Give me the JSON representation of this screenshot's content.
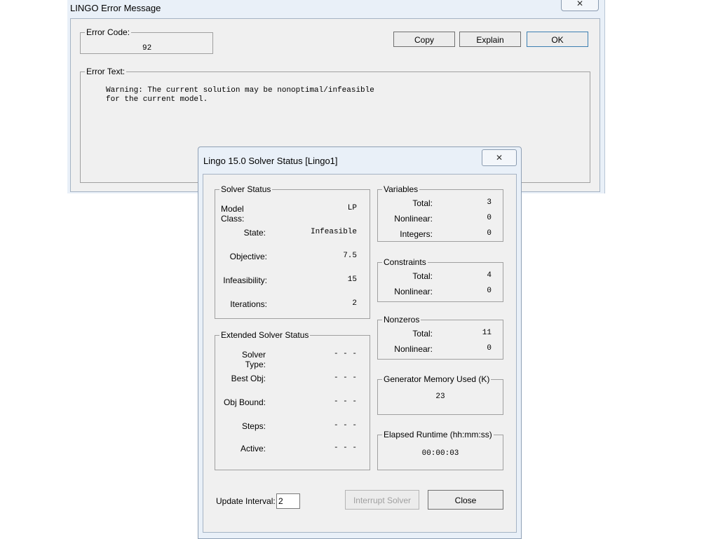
{
  "error_window": {
    "title": "LINGO Error Message",
    "close_glyph": "✕",
    "error_code": {
      "label": "Error Code:",
      "value": "92"
    },
    "buttons": {
      "copy": "Copy",
      "explain": "Explain",
      "ok": "OK"
    },
    "error_text": {
      "label": "Error Text:",
      "line1": "Warning: The current solution may be nonoptimal/infeasible",
      "line2": "for the current model."
    }
  },
  "solver_window": {
    "title": "Lingo 15.0 Solver Status [Lingo1]",
    "close_glyph": "✕",
    "solver_status": {
      "legend": "Solver Status",
      "model_class": {
        "label": "Model Class:",
        "value": "LP"
      },
      "state": {
        "label": "State:",
        "value": "Infeasible"
      },
      "objective": {
        "label": "Objective:",
        "value": "7.5"
      },
      "infeasibility": {
        "label": "Infeasibility:",
        "value": "15"
      },
      "iterations": {
        "label": "Iterations:",
        "value": "2"
      }
    },
    "extended_status": {
      "legend": "Extended Solver Status",
      "solver_type": {
        "label": "Solver Type:",
        "value": "- - -"
      },
      "best_obj": {
        "label": "Best Obj:",
        "value": "- - -"
      },
      "obj_bound": {
        "label": "Obj Bound:",
        "value": "- - -"
      },
      "steps": {
        "label": "Steps:",
        "value": "- - -"
      },
      "active": {
        "label": "Active:",
        "value": "- - -"
      }
    },
    "variables": {
      "legend": "Variables",
      "total": {
        "label": "Total:",
        "value": "3"
      },
      "nonlinear": {
        "label": "Nonlinear:",
        "value": "0"
      },
      "integers": {
        "label": "Integers:",
        "value": "0"
      }
    },
    "constraints": {
      "legend": "Constraints",
      "total": {
        "label": "Total:",
        "value": "4"
      },
      "nonlinear": {
        "label": "Nonlinear:",
        "value": "0"
      }
    },
    "nonzeros": {
      "legend": "Nonzeros",
      "total": {
        "label": "Total:",
        "value": "11"
      },
      "nonlinear": {
        "label": "Nonlinear:",
        "value": "0"
      }
    },
    "generator_memory": {
      "legend": "Generator Memory Used (K)",
      "value": "23"
    },
    "elapsed_runtime": {
      "legend": "Elapsed Runtime (hh:mm:ss)",
      "value": "00:00:03"
    },
    "update_interval": {
      "label": "Update Interval:",
      "value": "2"
    },
    "buttons": {
      "interrupt": "Interrupt Solver",
      "close": "Close"
    }
  }
}
